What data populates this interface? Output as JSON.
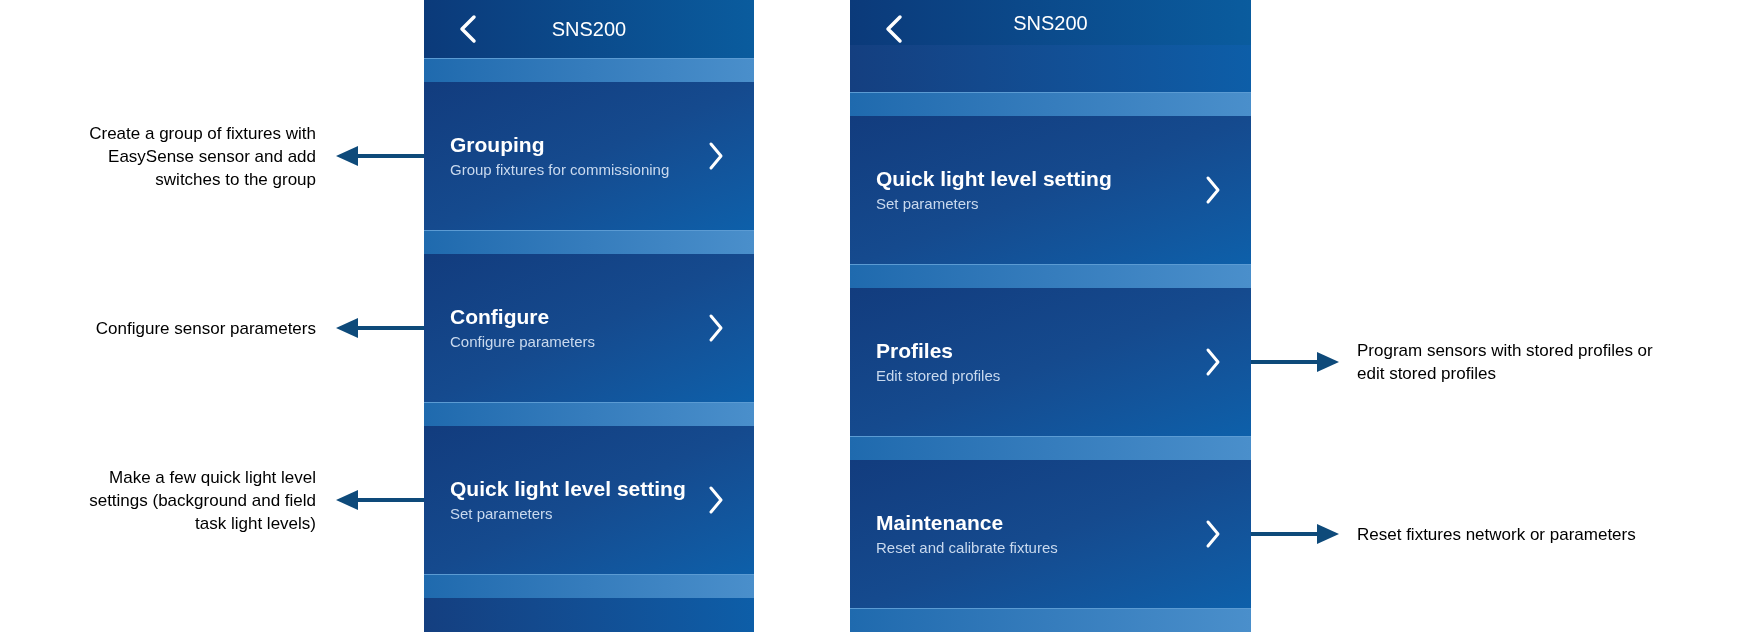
{
  "phones": [
    {
      "title": "SNS200",
      "items": [
        {
          "title": "Grouping",
          "subtitle": "Group fixtures for commissioning",
          "note": "Create a group of fixtures with EasySense sensor and add switches to the group"
        },
        {
          "title": "Configure",
          "subtitle": "Configure parameters",
          "note": "Configure sensor parameters"
        },
        {
          "title": "Quick light level setting",
          "subtitle": "Set parameters",
          "note": "Make a few quick light level settings (background and field task light levels)"
        }
      ]
    },
    {
      "title": "SNS200",
      "items": [
        {
          "title": "Quick light level setting",
          "subtitle": "Set parameters"
        },
        {
          "title": "Profiles",
          "subtitle": "Edit stored profiles",
          "note": "Program sensors with stored profiles or edit stored profiles"
        },
        {
          "title": "Maintenance",
          "subtitle": "Reset and calibrate fixtures",
          "note": "Reset fixtures network or parameters"
        }
      ]
    }
  ]
}
